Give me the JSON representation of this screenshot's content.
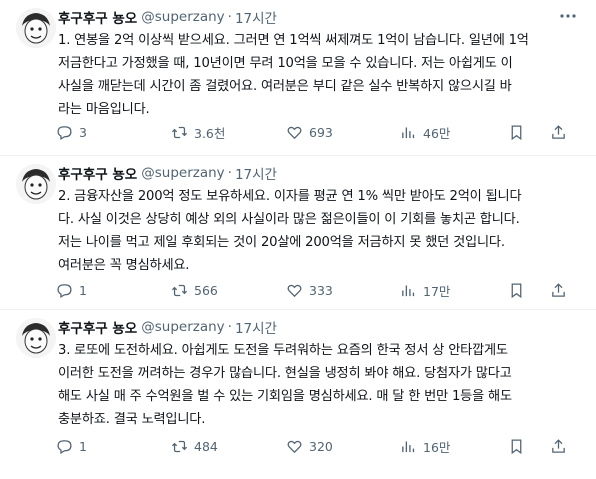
{
  "tweets": [
    {
      "name": "후구후구 뇽오",
      "handle": "@superzany",
      "time": "17시간",
      "lines": [
        "1. 연봉을 2억 이상씩 받으세요. 그러면 연 1억씩 써제껴도 1억이 남습니다. 일년에 1억",
        "저금한다고 가정했을 때, 10년이면 무려 10억을 모을 수 있습니다. 저는 아쉽게도 이",
        "사실을 깨닫는데 시간이 좀 걸렸어요. 여러분은 부디 같은 실수 반복하지 않으시길 바",
        "라는 마음입니다."
      ],
      "stats": {
        "replies": "3",
        "retweets": "3.6천",
        "likes": "693",
        "views": "46만"
      }
    },
    {
      "name": "후구후구 뇽오",
      "handle": "@superzany",
      "time": "17시간",
      "lines": [
        "2. 금융자산을 200억 정도 보유하세요. 이자를 평균 연 1% 씩만 받아도 2억이 됩니다",
        "다. 사실 이것은 상당히 예상 외의 사실이라 많은 젊은이들이 이 기회를 놓치곤 합니다.",
        "저는 나이를 먹고 제일 후회되는 것이 20살에 200억을 저금하지 못 했던 것입니다.",
        "여러분은 꼭 명심하세요."
      ],
      "stats": {
        "replies": "1",
        "retweets": "566",
        "likes": "333",
        "views": "17만"
      }
    },
    {
      "name": "후구후구 뇽오",
      "handle": "@superzany",
      "time": "17시간",
      "lines": [
        "3. 로또에 도전하세요. 아쉽게도 도전을 두려워하는 요즘의 한국 정서 상 안타깝게도",
        "이러한 도전을 꺼려하는 경우가 많습니다. 현실을 냉정히 봐야 해요. 당첨자가 많다고",
        "해도 사실 매 주 수억원을 벌 수 있는 기회임을 명심하세요. 매 달 한 번만 1등을 해도",
        "충분하죠. 결국 노력입니다."
      ],
      "stats": {
        "replies": "1",
        "retweets": "484",
        "likes": "320",
        "views": "16만"
      }
    }
  ],
  "separator": "·",
  "icons": {
    "more": "more-icon",
    "reply": "reply-icon",
    "retweet": "retweet-icon",
    "like": "heart-icon",
    "views": "views-icon",
    "bookmark": "bookmark-icon",
    "share": "share-icon"
  },
  "colors": {
    "text": "#0f1419",
    "secondary": "#536471",
    "divider": "#eff3f4"
  }
}
